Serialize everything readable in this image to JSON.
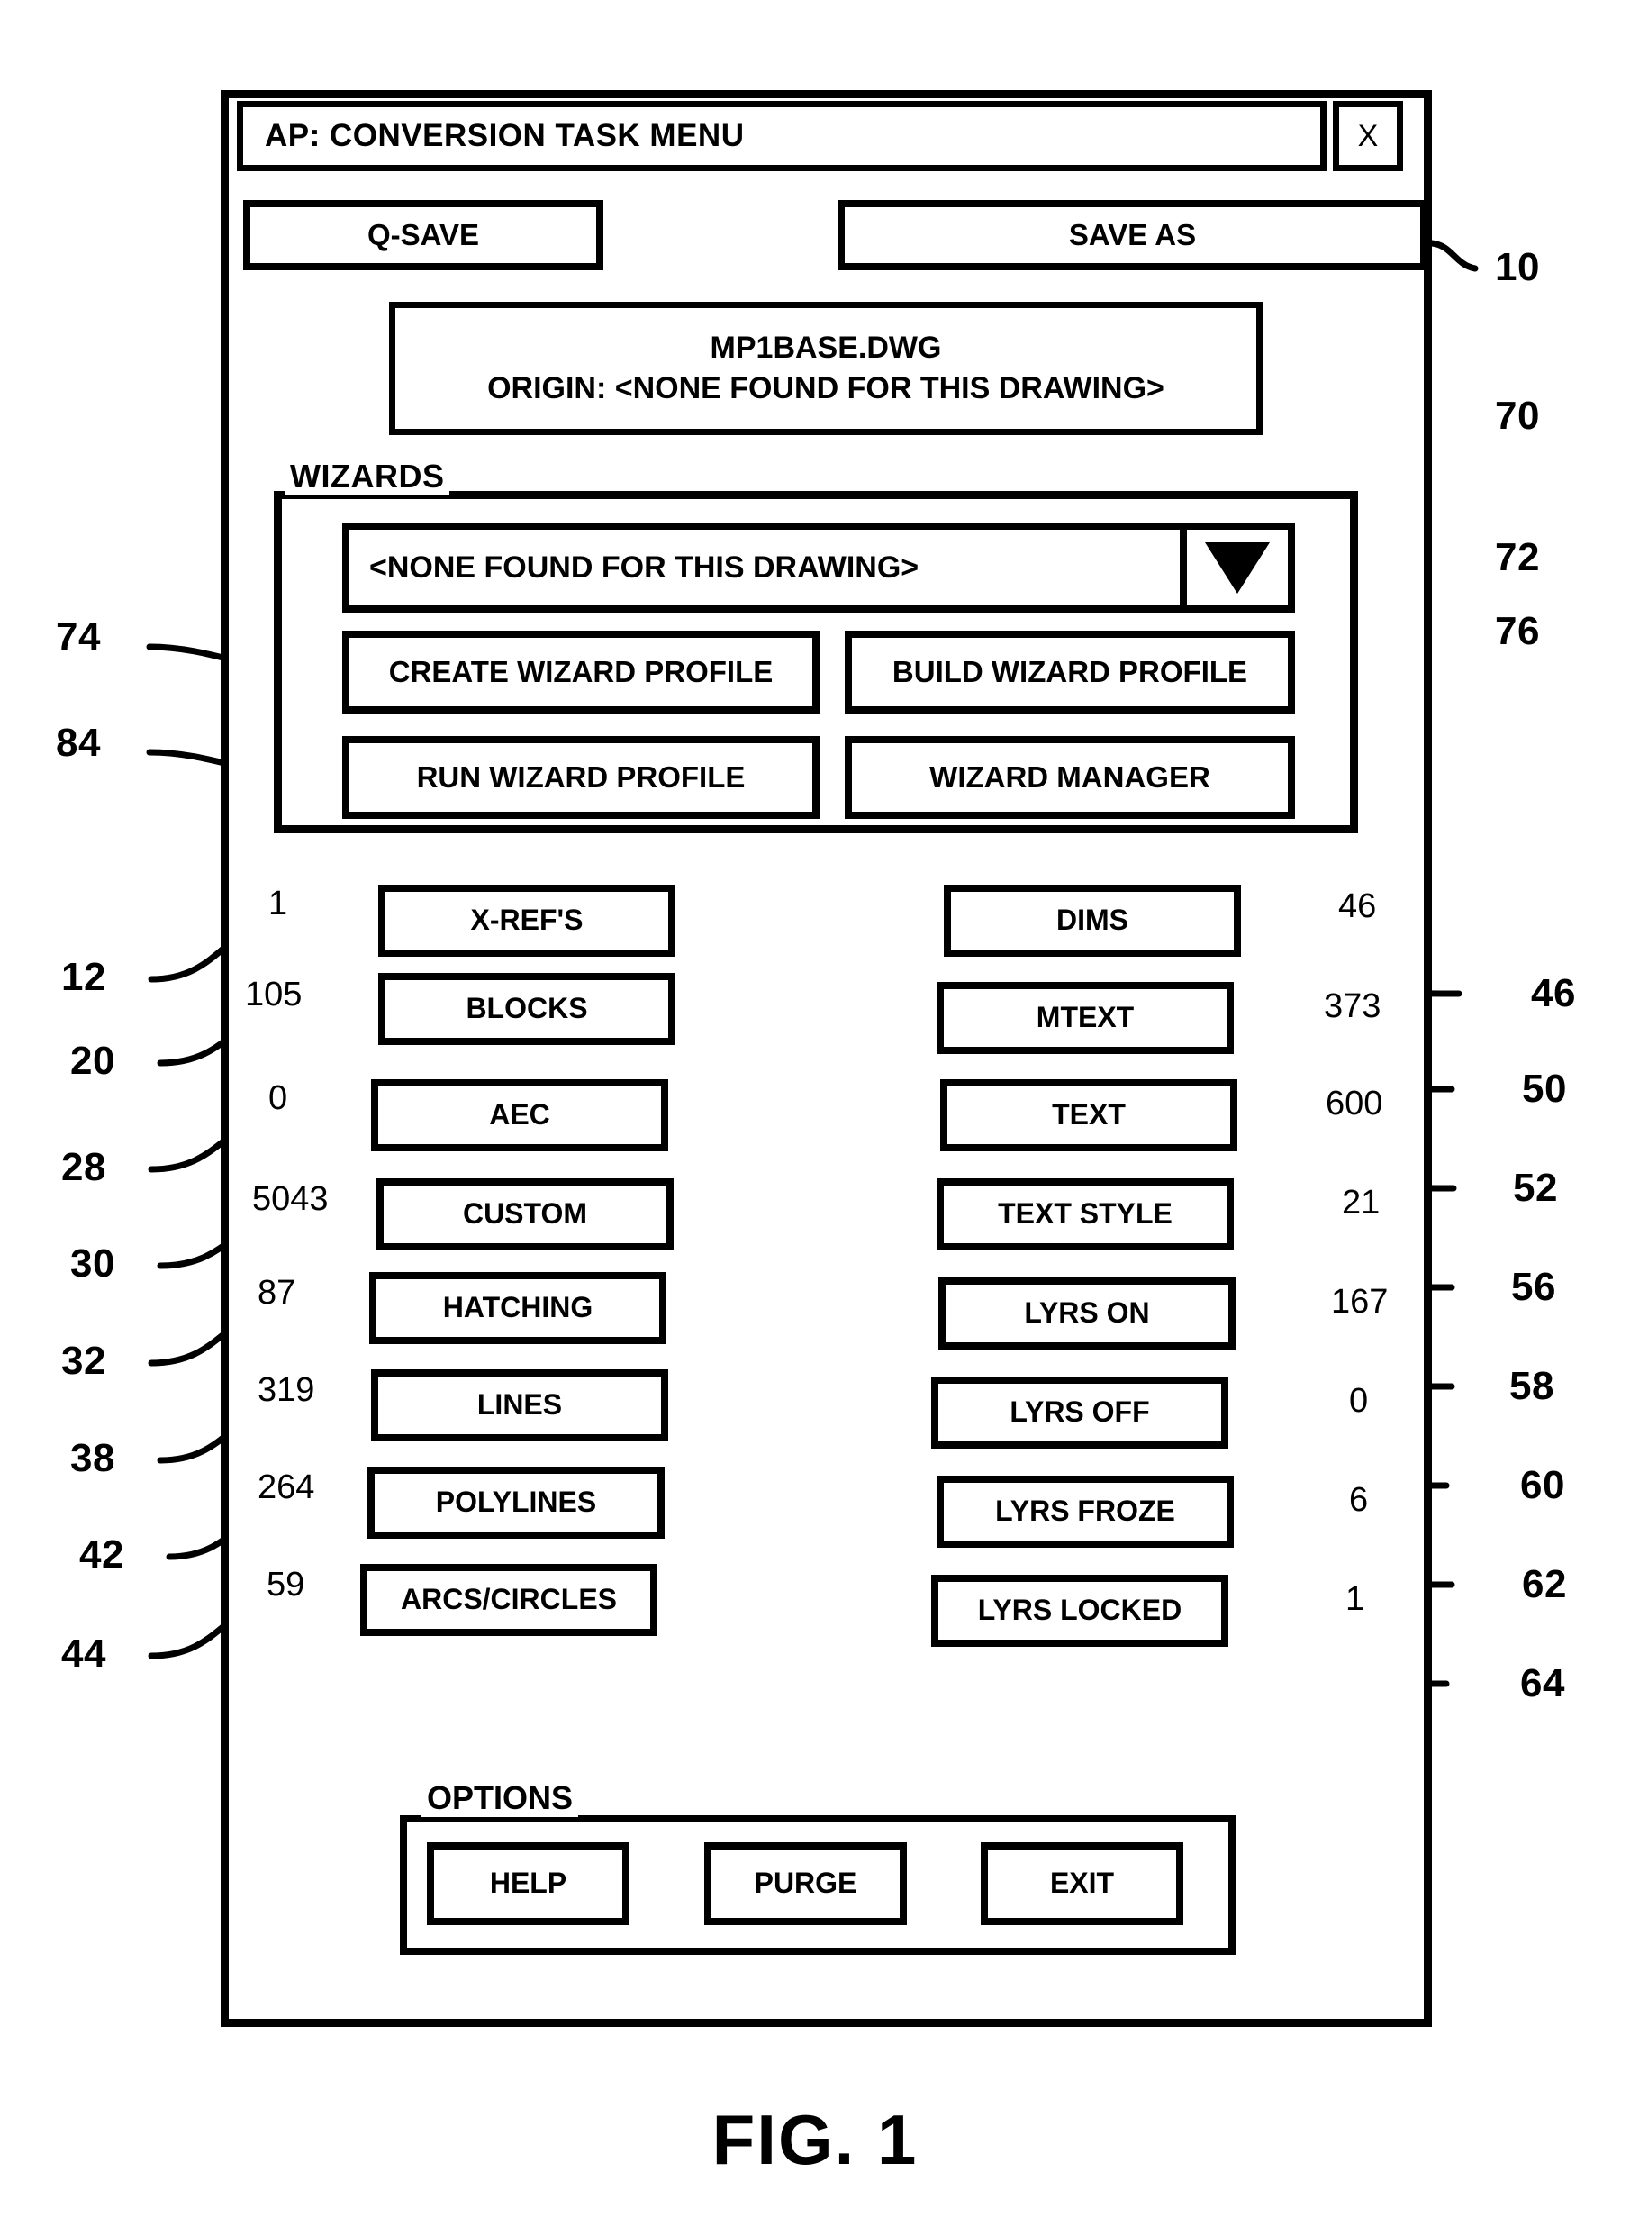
{
  "figure": {
    "caption": "FIG. 1"
  },
  "dialog": {
    "title": "AP: CONVERSION TASK MENU",
    "close_label": "X",
    "ref": "10"
  },
  "save_row": {
    "q_save_label": "Q-SAVE",
    "save_as_label": "SAVE AS"
  },
  "file_info": {
    "filename": "MP1BASE.DWG",
    "origin": "ORIGIN: <NONE FOUND FOR THIS DRAWING>"
  },
  "wizards": {
    "group_label": "WIZARDS",
    "group_ref": "70",
    "select_value": "<NONE FOUND FOR THIS DRAWING>",
    "select_ref": "72",
    "arrow_icon": "chevron-down-icon",
    "buttons": [
      {
        "label": "CREATE WIZARD PROFILE",
        "ref": "74"
      },
      {
        "label": "BUILD WIZARD PROFILE",
        "ref": "76"
      },
      {
        "label": "RUN WIZARD PROFILE",
        "ref": "84"
      },
      {
        "label": "WIZARD MANAGER",
        "ref": ""
      }
    ]
  },
  "entities": {
    "left_column": [
      {
        "label": "X-REF'S",
        "count": "1",
        "ref": "12"
      },
      {
        "label": "BLOCKS",
        "count": "105",
        "ref": "20"
      },
      {
        "label": "AEC",
        "count": "0",
        "ref": "28"
      },
      {
        "label": "CUSTOM",
        "count": "5043",
        "ref": "30"
      },
      {
        "label": "HATCHING",
        "count": "87",
        "ref": "32"
      },
      {
        "label": "LINES",
        "count": "319",
        "ref": "38"
      },
      {
        "label": "POLYLINES",
        "count": "264",
        "ref": "42"
      },
      {
        "label": "ARCS/CIRCLES",
        "count": "59",
        "ref": "44"
      }
    ],
    "right_column": [
      {
        "label": "DIMS",
        "count": "46",
        "ref": "46"
      },
      {
        "label": "MTEXT",
        "count": "373",
        "ref": "50"
      },
      {
        "label": "TEXT",
        "count": "600",
        "ref": "52"
      },
      {
        "label": "TEXT STYLE",
        "count": "21",
        "ref": "56"
      },
      {
        "label": "LYRS ON",
        "count": "167",
        "ref": "58"
      },
      {
        "label": "LYRS OFF",
        "count": "0",
        "ref": "60"
      },
      {
        "label": "LYRS FROZE",
        "count": "6",
        "ref": "62"
      },
      {
        "label": "LYRS LOCKED",
        "count": "1",
        "ref": "64"
      }
    ]
  },
  "options": {
    "group_label": "OPTIONS",
    "buttons": [
      {
        "label": "HELP"
      },
      {
        "label": "PURGE"
      },
      {
        "label": "EXIT"
      }
    ]
  },
  "colors": {
    "ink": "#000000",
    "paper": "#ffffff"
  }
}
